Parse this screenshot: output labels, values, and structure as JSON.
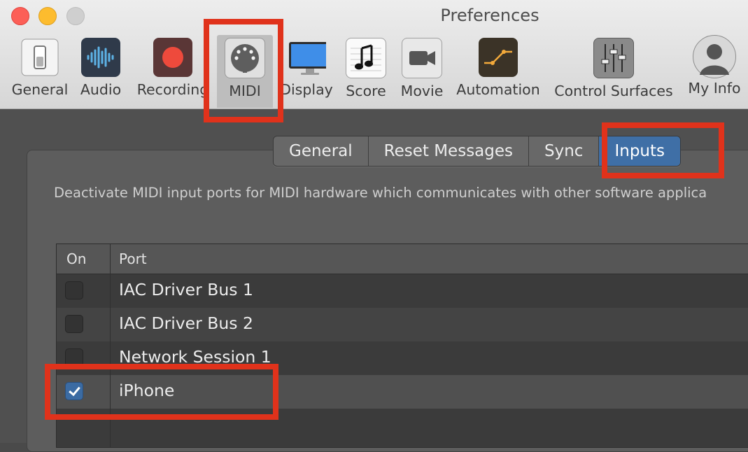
{
  "window": {
    "title": "Preferences"
  },
  "toolbar": {
    "items": [
      {
        "label": "General"
      },
      {
        "label": "Audio"
      },
      {
        "label": "Recording"
      },
      {
        "label": "MIDI"
      },
      {
        "label": "Display"
      },
      {
        "label": "Score"
      },
      {
        "label": "Movie"
      },
      {
        "label": "Automation"
      },
      {
        "label": "Control Surfaces"
      },
      {
        "label": "My Info"
      }
    ],
    "selected": "MIDI"
  },
  "midi": {
    "tabs": [
      {
        "label": "General"
      },
      {
        "label": "Reset Messages"
      },
      {
        "label": "Sync"
      },
      {
        "label": "Inputs"
      }
    ],
    "active_tab": "Inputs",
    "description": "Deactivate MIDI input ports for MIDI hardware which communicates with other software applica",
    "table": {
      "headers": {
        "on": "On",
        "port": "Port"
      },
      "rows": [
        {
          "port": "IAC Driver Bus 1",
          "on": false
        },
        {
          "port": "IAC Driver Bus 2",
          "on": false
        },
        {
          "port": "Network Session 1",
          "on": false
        },
        {
          "port": "iPhone",
          "on": true
        }
      ]
    }
  },
  "colors": {
    "accent": "#3f6fa6",
    "highlight": "#e0321b"
  }
}
